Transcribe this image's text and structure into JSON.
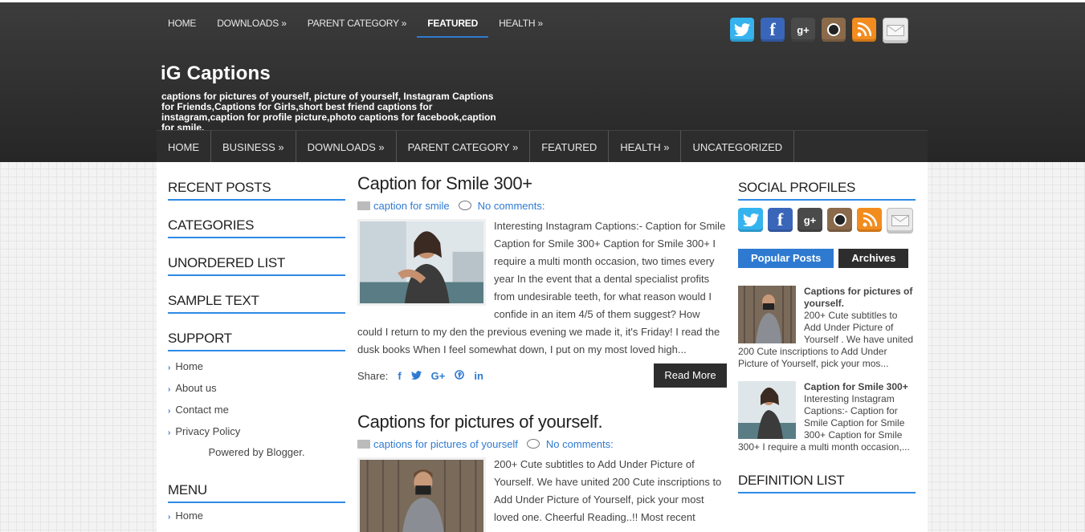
{
  "top_nav": {
    "items": [
      {
        "label": "HOME"
      },
      {
        "label": "DOWNLOADS »"
      },
      {
        "label": "PARENT CATEGORY »"
      },
      {
        "label": "FEATURED"
      },
      {
        "label": "HEALTH »"
      }
    ]
  },
  "social_icons": {
    "twitter": "twitter-icon",
    "facebook": "facebook-icon",
    "google_plus": "google-plus-icon",
    "instagram": "instagram-icon",
    "rss": "rss-icon",
    "email": "email-icon"
  },
  "site": {
    "title": "iG Captions",
    "tagline": "captions for pictures of yourself, picture of yourself, Instagram Captions for Friends,Captions for Girls,short best friend captions for instagram,caption for profile picture,photo captions for facebook,caption for smile."
  },
  "main_nav": {
    "items": [
      {
        "label": "HOME"
      },
      {
        "label": "BUSINESS »"
      },
      {
        "label": "DOWNLOADS »"
      },
      {
        "label": "PARENT CATEGORY »"
      },
      {
        "label": "FEATURED"
      },
      {
        "label": "HEALTH »"
      },
      {
        "label": "UNCATEGORIZED"
      }
    ]
  },
  "left_sidebar": {
    "widgets": [
      "RECENT POSTS",
      "CATEGORIES",
      "UNORDERED LIST",
      "SAMPLE TEXT",
      "SUPPORT"
    ],
    "support_links": [
      "Home",
      "About us",
      "Contact me",
      "Privacy Policy"
    ],
    "powered": "Powered by Blogger.",
    "menu_title": "MENU",
    "menu_first": "Home"
  },
  "posts": [
    {
      "title": "Caption for Smile 300+",
      "label": "caption for smile",
      "comments": "No comments:",
      "snippet": "Interesting Instagram Captions:- Caption for Smile Caption for Smile 300+ Caption for Smile 300+ I require a multi month occasion, two times every year In the event that a dental specialist profits from undesirable teeth, for what reason would I confide in an item 4/5 of them suggest? How could I return to my den the previous evening we made it, it's Friday! I read the dusk books When I feel somewhat down, I put on my most loved high...",
      "share_label": "Share:",
      "read_more": "Read More"
    },
    {
      "title": "Captions for pictures of yourself.",
      "label": "captions for pictures of yourself",
      "comments": "No comments:",
      "snippet": "200+ Cute subtitles to Add Under Picture of Yourself. We have united 200 Cute inscriptions to Add Under Picture of Yourself, pick your most loved one. Cheerful Reading..!! Most recent"
    }
  ],
  "right_sidebar": {
    "social_title": "SOCIAL PROFILES",
    "tab_popular": "Popular Posts",
    "tab_archives": "Archives",
    "popular": [
      {
        "title": "Captions for pictures of yourself.",
        "snippet": "200+ Cute subtitles to Add Under Picture of Yourself . We have united 200 Cute inscriptions to Add Under Picture of Yourself, pick your mos..."
      },
      {
        "title": "Caption for Smile 300+",
        "snippet": "Interesting Instagram Captions:-  Caption for Smile Caption for Smile 300+ Caption for Smile 300+ I require a multi month occasion,..."
      }
    ],
    "definition_title": "DEFINITION LIST"
  },
  "colors": {
    "accent": "#2e7ad1",
    "header_dark": "#2d2d2d"
  }
}
